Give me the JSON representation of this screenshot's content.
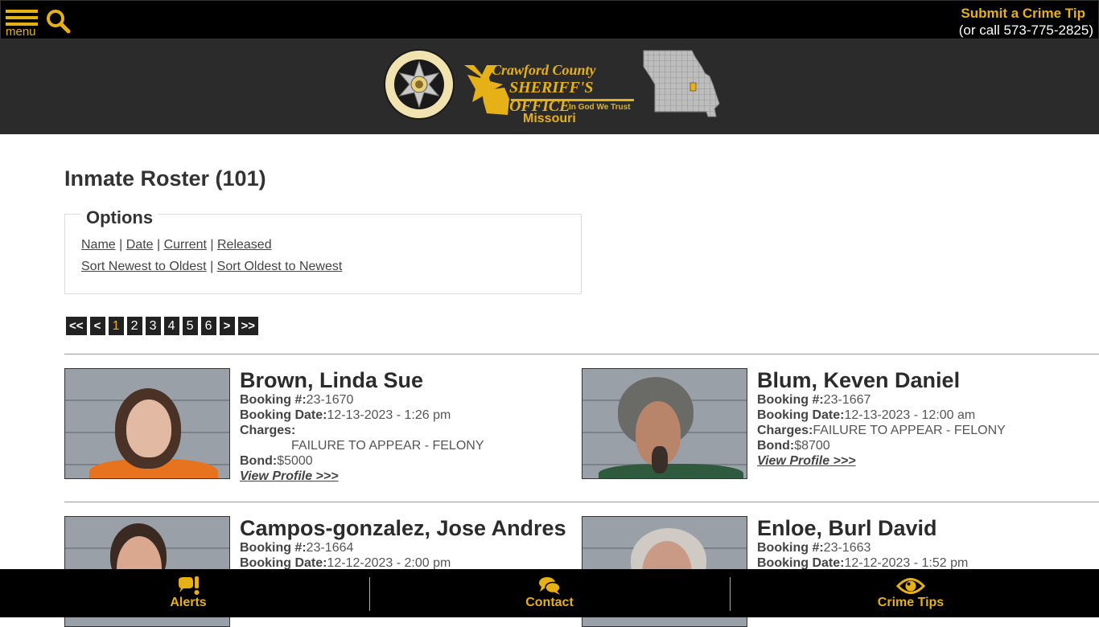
{
  "topbar": {
    "menu_label": "menu",
    "crime_tip_title": "Submit a Crime Tip",
    "crime_tip_phone": "(or call 573-775-2825)"
  },
  "banner": {
    "seal_text_top": "CRAWFORD COUNTY",
    "seal_text_bottom": "SHERIFF'S OFFICE",
    "wordmark_line1": "Crawford County",
    "wordmark_line2": "SHERIFF'S OFFICE",
    "motto": "In God We Trust",
    "state": "Missouri"
  },
  "page": {
    "title": "Inmate Roster (101)"
  },
  "options": {
    "legend": "Options",
    "filters": [
      "Name",
      "Date",
      "Current",
      "Released"
    ],
    "sorts": [
      "Sort Newest to Oldest",
      "Sort Oldest to Newest"
    ],
    "separator": " | "
  },
  "pager": {
    "first": "<<",
    "prev": "<",
    "pages": [
      "1",
      "2",
      "3",
      "4",
      "5",
      "6"
    ],
    "current": "1",
    "next": ">",
    "last": ">>"
  },
  "labels": {
    "booking_no": "Booking #:",
    "booking_date": "Booking Date:",
    "charges": "Charges:",
    "bond": "Bond:",
    "view_profile": "View Profile >>>"
  },
  "inmates": [
    {
      "name": "Brown, Linda Sue",
      "booking_no": "23-1670",
      "booking_date": "12-13-2023 - 1:26 pm",
      "charges": "FAILURE TO APPEAR - FELONY",
      "bond": "$5000"
    },
    {
      "name": "Blum, Keven Daniel",
      "booking_no": "23-1667",
      "booking_date": "12-13-2023 - 12:00 am",
      "charges": "FAILURE TO APPEAR - FELONY",
      "bond": "$8700"
    },
    {
      "name": "Campos-gonzalez, Jose Andres",
      "booking_no": "23-1664",
      "booking_date": "12-12-2023 - 2:00 pm"
    },
    {
      "name": "Enloe, Burl David",
      "booking_no": "23-1663",
      "booking_date": "12-12-2023 - 1:52 pm"
    }
  ],
  "bottombar": {
    "alerts": "Alerts",
    "contact": "Contact",
    "crime_tips": "Crime Tips"
  },
  "colors": {
    "accent": "#e6b117",
    "banner_bg": "#2b2b2b",
    "bar_bg": "#000000"
  }
}
